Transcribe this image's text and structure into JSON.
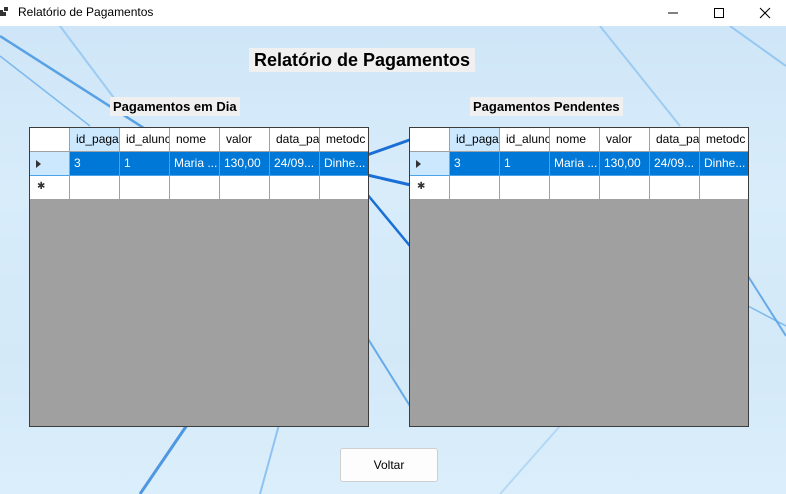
{
  "window": {
    "title": "Relatório de Pagamentos",
    "controls": {
      "minimize_icon": "minimize-icon",
      "maximize_icon": "maximize-icon",
      "close_icon": "close-icon"
    }
  },
  "report": {
    "title": "Relatório de Pagamentos"
  },
  "grid_left": {
    "label": "Pagamentos em Dia",
    "columns": [
      "id_paga",
      "id_alunc",
      "nome",
      "valor",
      "data_pa",
      "metodc"
    ],
    "rows": [
      [
        "3",
        "1",
        "Maria ...",
        "130,00",
        "24/09...",
        "Dinhe..."
      ]
    ]
  },
  "grid_right": {
    "label": "Pagamentos Pendentes",
    "columns": [
      "id_paga",
      "id_alunc",
      "nome",
      "valor",
      "data_pa",
      "metodc"
    ],
    "rows": [
      [
        "3",
        "1",
        "Maria ...",
        "130,00",
        "24/09...",
        "Dinhe..."
      ]
    ]
  },
  "buttons": {
    "voltar": "Voltar"
  },
  "colors": {
    "selection": "#0078d7",
    "grid_background": "#a0a0a0",
    "header_highlight": "#cce8ff"
  }
}
